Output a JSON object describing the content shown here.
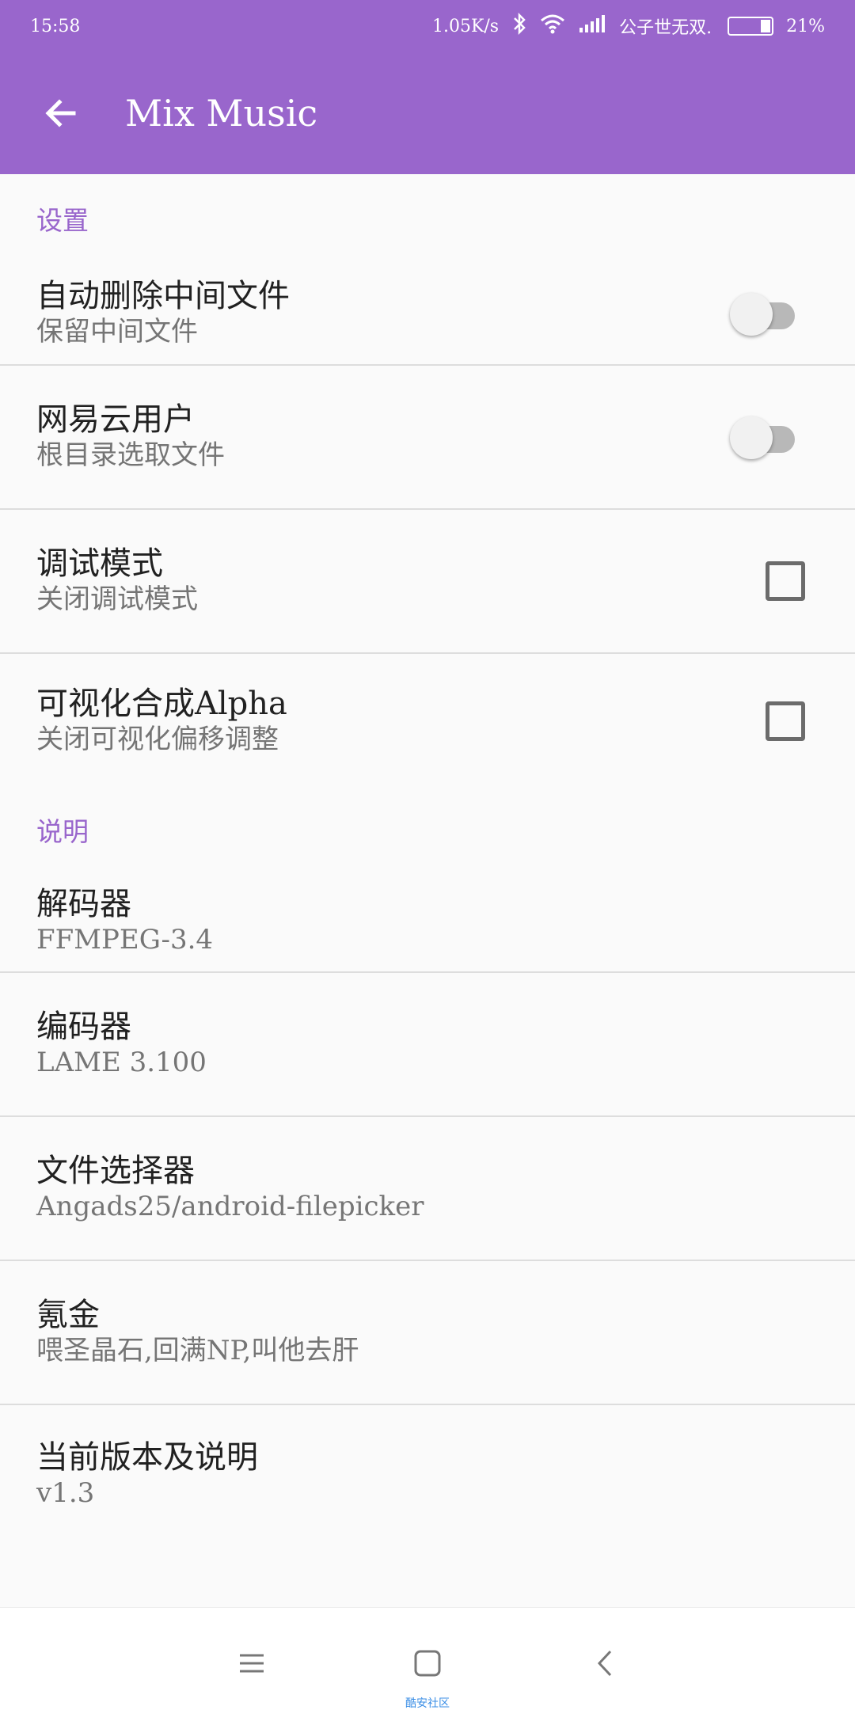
{
  "status_bar": {
    "time": "15:58",
    "net_speed": "1.05K/s",
    "carrier": "公子世无双.",
    "battery": "21%",
    "icons": [
      "bluetooth-icon",
      "wifi-icon",
      "signal-icon",
      "battery-icon"
    ]
  },
  "app_bar": {
    "title": "Mix Music",
    "back_icon": "arrow-back-icon",
    "color": "#9966cc"
  },
  "sections": {
    "settings": {
      "header": "设置",
      "items": [
        {
          "title": "自动删除中间文件",
          "summary": "保留中间文件",
          "control": "switch",
          "checked": false
        },
        {
          "title": "网易云用户",
          "summary": "根目录选取文件",
          "control": "switch",
          "checked": false
        },
        {
          "title": "调试模式",
          "summary": "关闭调试模式",
          "control": "checkbox",
          "checked": false
        },
        {
          "title": "可视化合成Alpha",
          "summary": "关闭可视化偏移调整",
          "control": "checkbox",
          "checked": false
        }
      ]
    },
    "about": {
      "header": "说明",
      "items": [
        {
          "title": "解码器",
          "summary": "FFMPEG-3.4"
        },
        {
          "title": "编码器",
          "summary": "LAME 3.100"
        },
        {
          "title": "文件选择器",
          "summary": "Angads25/android-filepicker"
        },
        {
          "title": "氪金",
          "summary": "喂圣晶石,回满NP,叫他去肝"
        },
        {
          "title": "当前版本及说明",
          "summary": "v1.3"
        }
      ]
    }
  },
  "nav_bar": {
    "buttons": [
      "menu-icon",
      "home-icon",
      "back-icon"
    ],
    "watermark": "酷安社区"
  }
}
